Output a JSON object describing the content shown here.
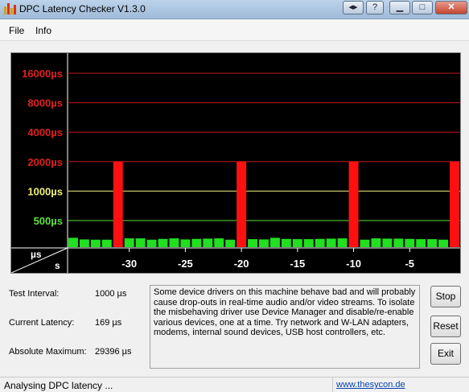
{
  "window": {
    "title": "DPC Latency Checker V1.3.0"
  },
  "menu": {
    "items": [
      "File",
      "Info"
    ]
  },
  "chart_data": {
    "type": "bar",
    "ylabel": "µs",
    "xlabel": "s",
    "y_scale": "log",
    "y_ticks": [
      {
        "label": "16000µs",
        "value": 16000,
        "color": "#e02020"
      },
      {
        "label": "8000µs",
        "value": 8000,
        "color": "#e02020"
      },
      {
        "label": "4000µs",
        "value": 4000,
        "color": "#e02020"
      },
      {
        "label": "2000µs",
        "value": 2000,
        "color": "#e02020"
      },
      {
        "label": "1000µs",
        "value": 1000,
        "color": "#f0f080"
      },
      {
        "label": "500µs",
        "value": 500,
        "color": "#60e040"
      }
    ],
    "x_ticks": [
      "-30",
      "-25",
      "-20",
      "-15",
      "-10",
      "-5"
    ],
    "x_tick_values": [
      -30,
      -25,
      -20,
      -15,
      -10,
      -5
    ],
    "x_range": [
      -35,
      -1
    ],
    "series": [
      {
        "x": [
          -35,
          -34,
          -33,
          -32,
          -31,
          -30,
          -29,
          -28,
          -27,
          -26,
          -25,
          -24,
          -23,
          -22,
          -21,
          -20,
          -19,
          -18,
          -17,
          -16,
          -15,
          -14,
          -13,
          -12,
          -11,
          -10,
          -9,
          -8,
          -7,
          -6,
          -5,
          -4,
          -3,
          -2,
          -1
        ],
        "values": [
          175,
          145,
          140,
          140,
          2000,
          165,
          165,
          140,
          155,
          165,
          145,
          155,
          160,
          165,
          140,
          2000,
          150,
          145,
          175,
          155,
          150,
          150,
          155,
          160,
          165,
          2000,
          140,
          165,
          160,
          160,
          155,
          150,
          150,
          140,
          2000
        ]
      }
    ]
  },
  "info": {
    "test_interval_label": "Test Interval:",
    "test_interval_value": "1000 µs",
    "current_latency_label": "Current Latency:",
    "current_latency_value": "169 µs",
    "absolute_max_label": "Absolute Maximum:",
    "absolute_max_value": "29396 µs"
  },
  "description": "Some device drivers on this machine behave bad and will probably cause drop-outs in real-time audio and/or video streams. To isolate the misbehaving driver use Device Manager and disable/re-enable various devices, one at a time. Try network and W-LAN adapters, modems, internal sound devices, USB host controllers, etc.",
  "buttons": {
    "stop": "Stop",
    "reset": "Reset",
    "exit": "Exit"
  },
  "status": {
    "text": "Analysing DPC latency ...",
    "link": "www.thesycon.de"
  },
  "colors": {
    "bar_normal": "#20e020",
    "bar_alarm": "#ff1010",
    "graph_bg": "#000000"
  }
}
